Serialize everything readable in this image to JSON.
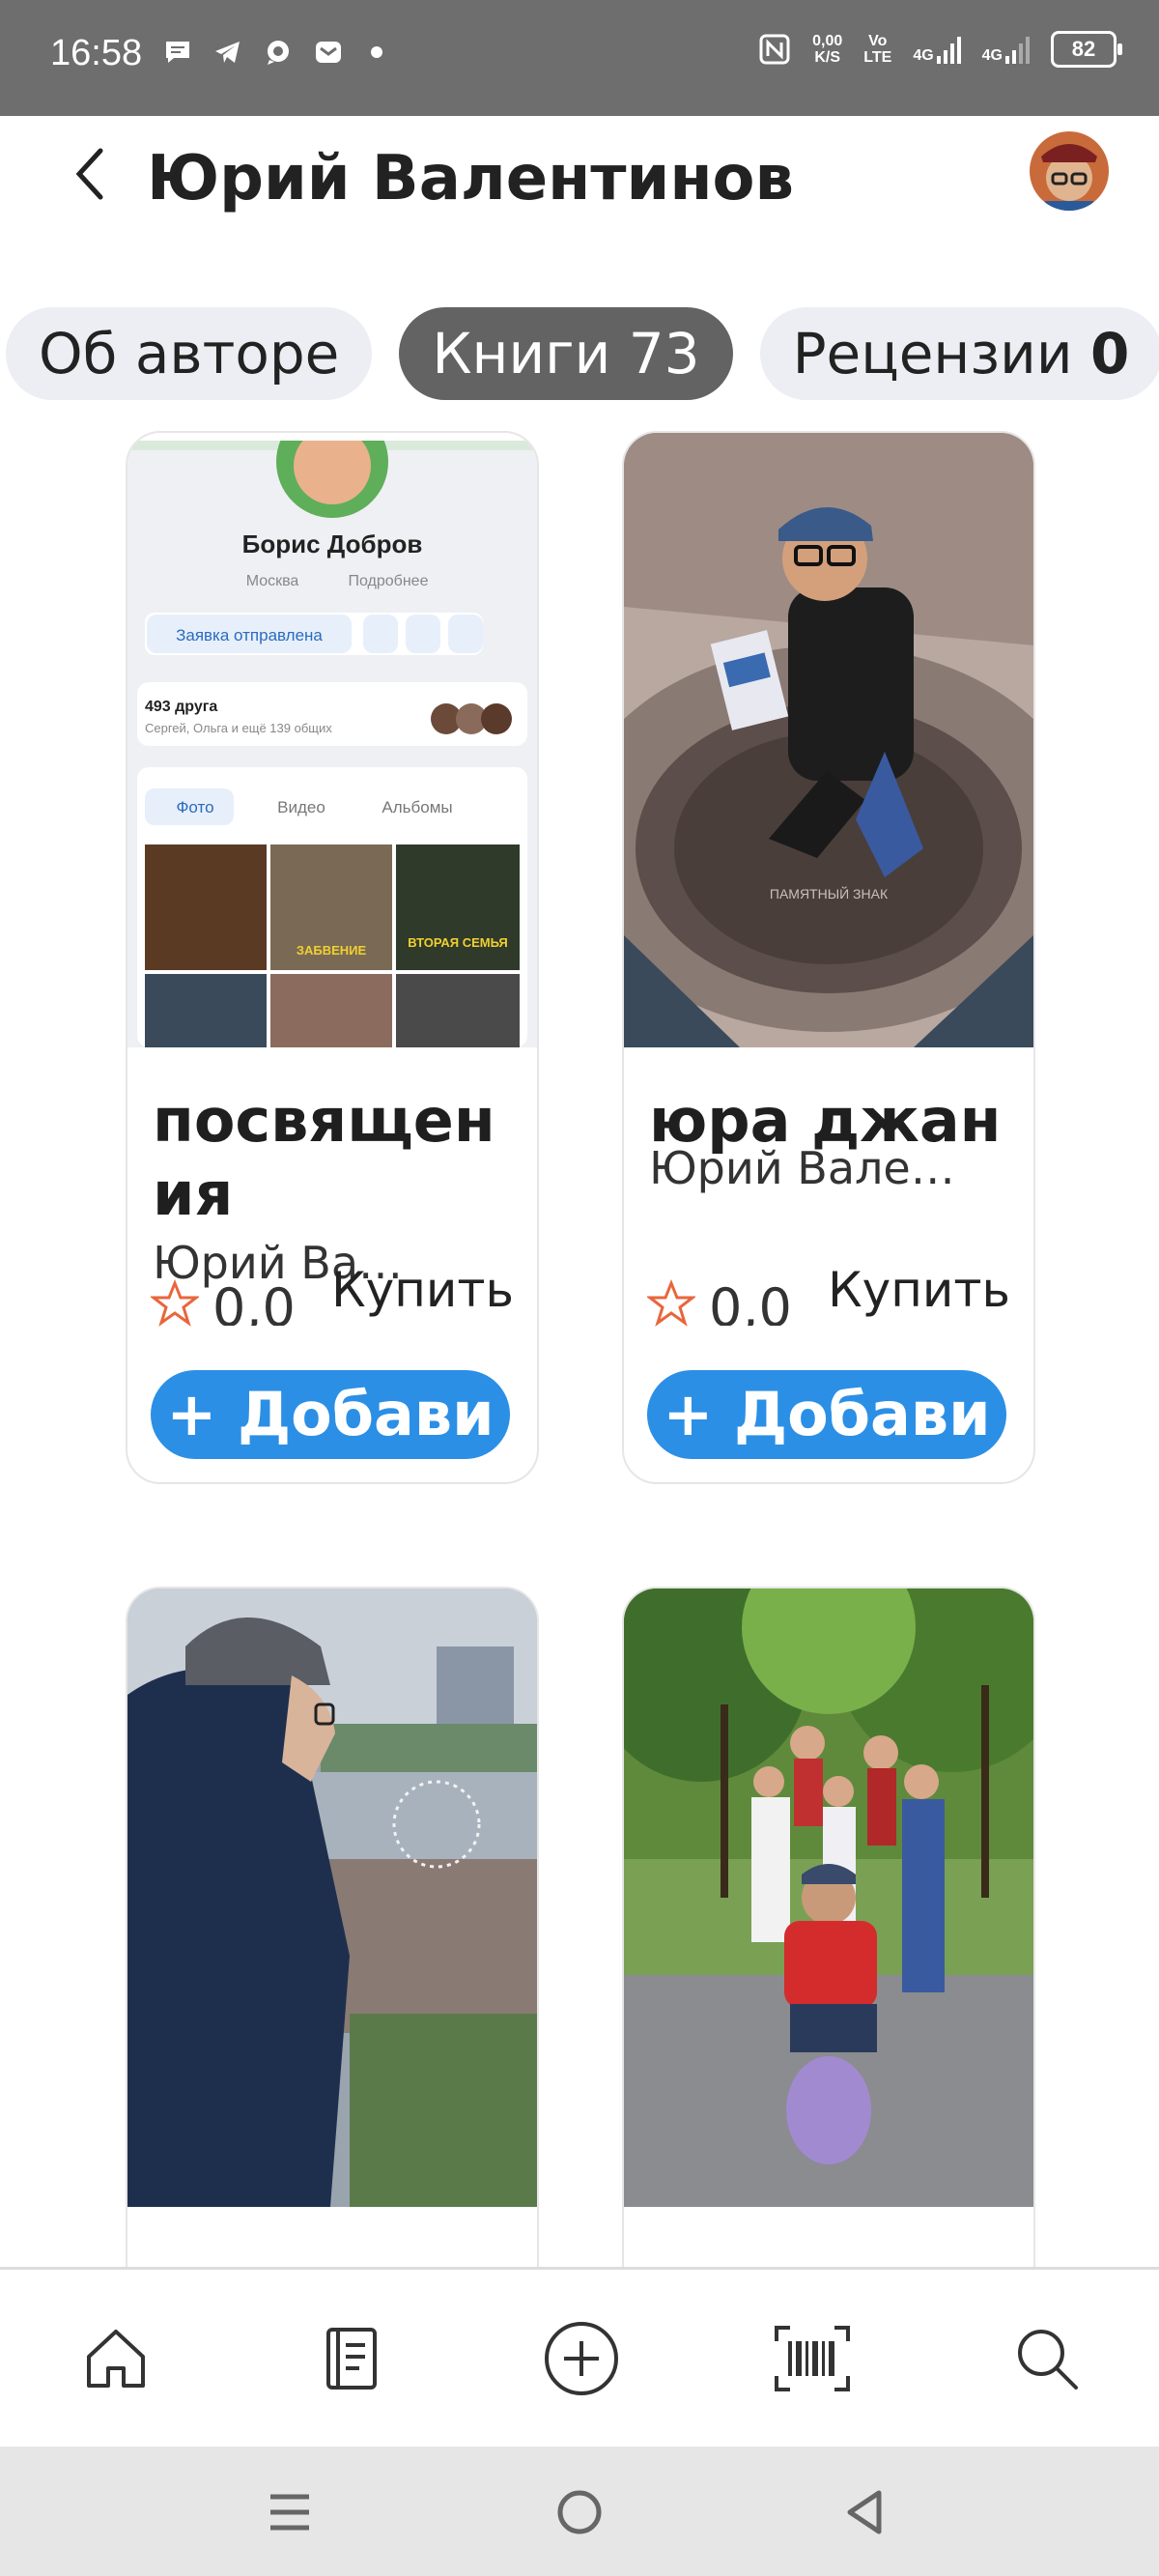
{
  "status_bar": {
    "time": "16:58",
    "net_speed_top": "0,00",
    "net_speed_bottom": "K/S",
    "volte_top": "Vo",
    "volte_bottom": "LTE",
    "net1": "4G",
    "net2": "4G",
    "battery": "82"
  },
  "header": {
    "title": "Юрий Валентинов"
  },
  "tabs": [
    {
      "label": "Об авторе",
      "count": ""
    },
    {
      "label": "Книги",
      "count": "73"
    },
    {
      "label": "Рецензии",
      "count": "0"
    }
  ],
  "books": [
    {
      "title": "посвящения",
      "author": "Юрий Вале…",
      "rating": "0,0",
      "buy_label": "Купить",
      "add_label": "+ Добави"
    },
    {
      "title": "юра джан",
      "author": "Юрий Вале…",
      "rating": "0,0",
      "buy_label": "Купить",
      "add_label": "+ Добави"
    },
    {
      "title": "",
      "author": ""
    },
    {
      "title": "",
      "author": ""
    }
  ],
  "cover1": {
    "profile_name": "Борис Добров",
    "location": "Москва",
    "more": "Подробнее",
    "request_sent": "Заявка отправлена",
    "friends": "493 друга",
    "friends_sub": "Сергей, Ольга и ещё 139 общих",
    "tab_photo": "Фото",
    "tab_video": "Видео",
    "tab_albums": "Альбомы",
    "thumb_label_1": "ЗАБВЕНИЕ",
    "thumb_label_2": "ВТОРАЯ СЕМЬЯ"
  },
  "cover2": {
    "plaque": "ПАМЯТНЫЙ ЗНАК"
  },
  "nav": [
    "home-icon",
    "book-icon",
    "add-icon",
    "barcode-icon",
    "search-icon"
  ],
  "system_nav": [
    "menu-icon",
    "home-circle-icon",
    "back-triangle-icon"
  ],
  "colors": {
    "accent": "#2c8fe6",
    "active_tab": "#636363",
    "tab_bg": "#eceef3",
    "star": "#e8663d"
  }
}
